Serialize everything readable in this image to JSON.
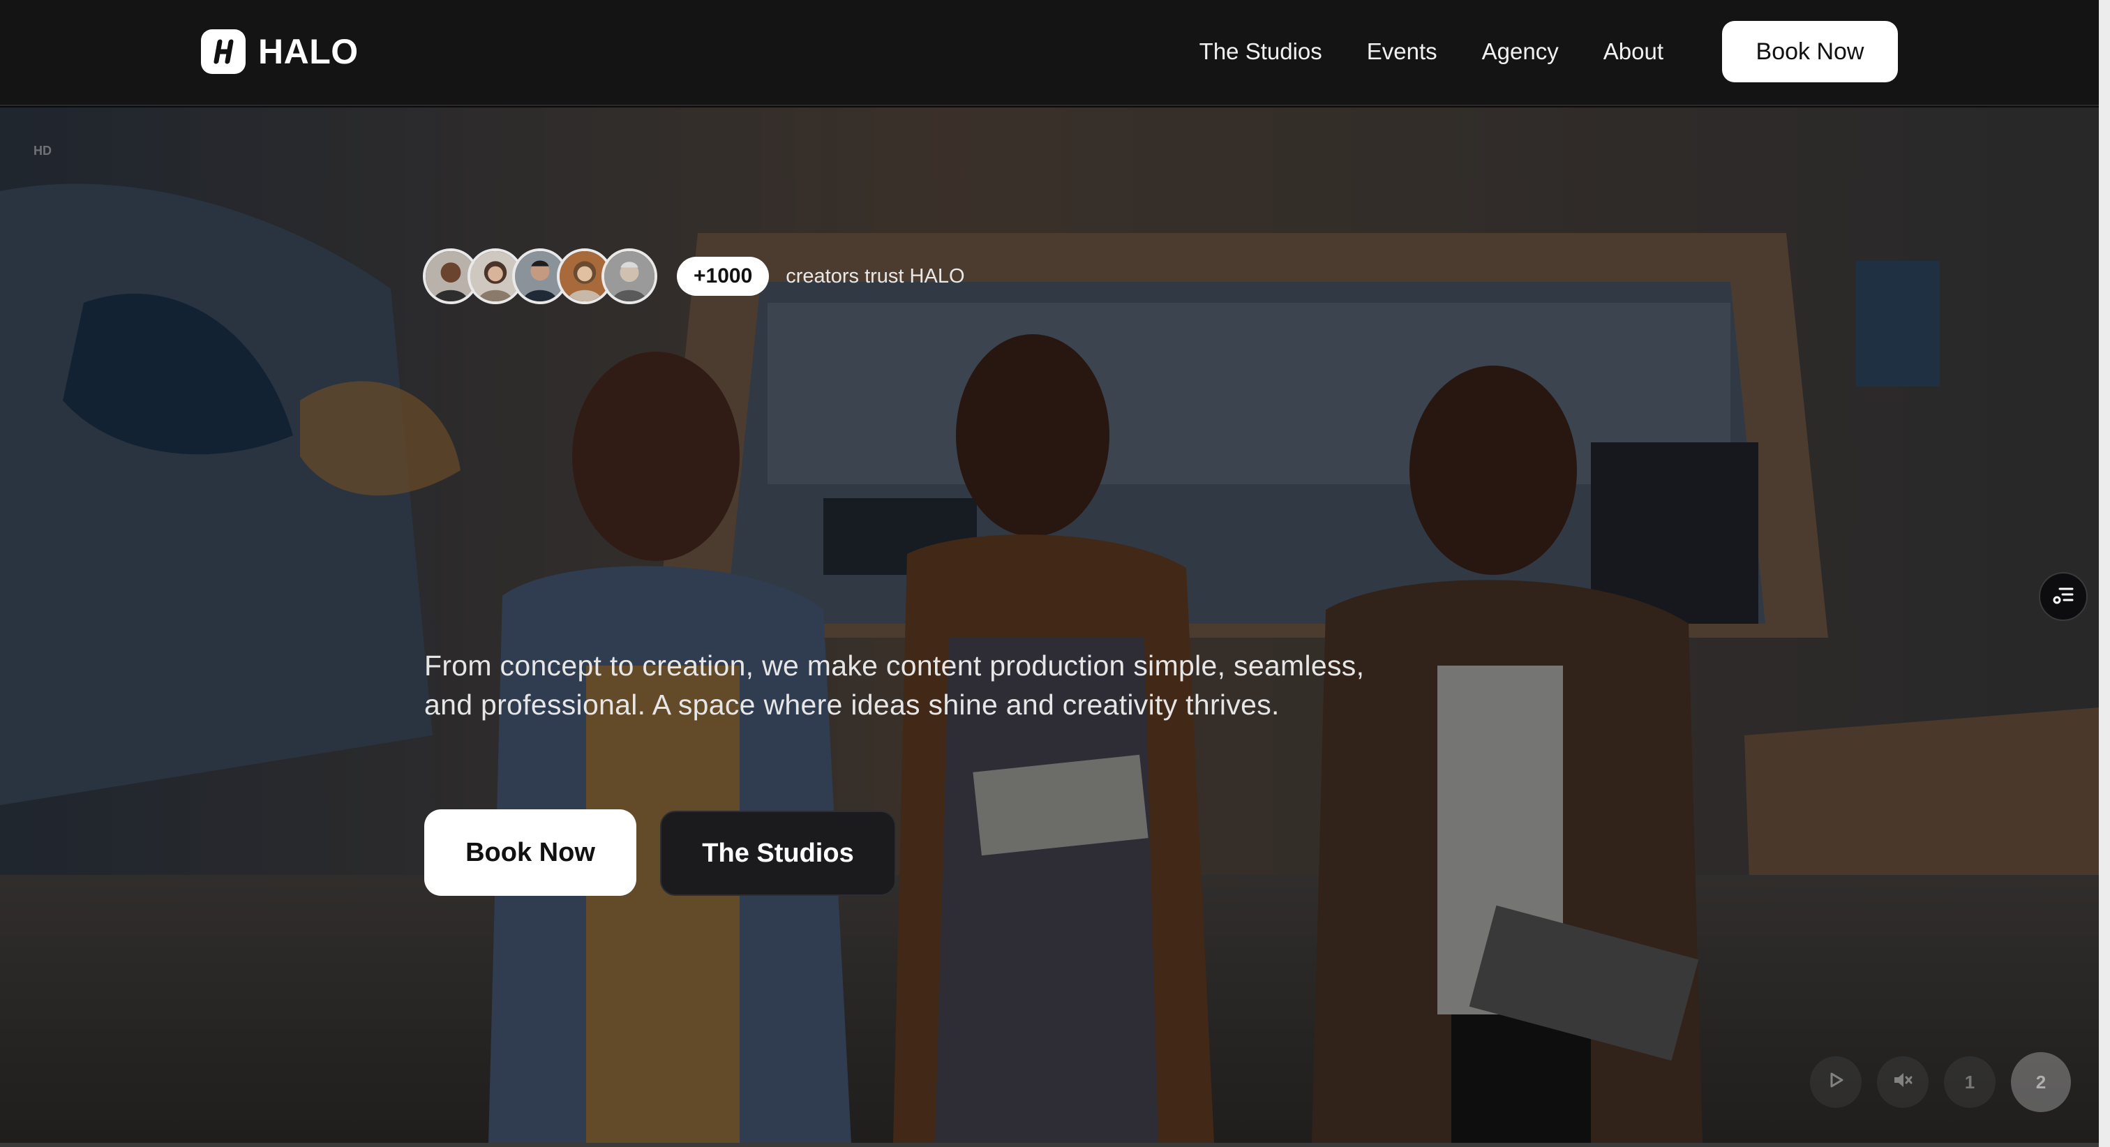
{
  "brand": {
    "name": "HALO",
    "logo_icon": "halo-logo-icon"
  },
  "nav": {
    "links": [
      "The Studios",
      "Events",
      "Agency",
      "About"
    ],
    "cta": "Book Now"
  },
  "hero": {
    "video_quality": "HD",
    "trust": {
      "count": "+1000",
      "text": "creators trust HALO",
      "avatar_count": 5
    },
    "description": "From concept to creation, we make content production simple, seamless, and professional. A space where ideas shine and creativity thrives.",
    "primary_cta": "Book Now",
    "secondary_cta": "The Studios"
  },
  "slider": {
    "controls": [
      {
        "icon": "play-icon",
        "label": ""
      },
      {
        "icon": "volume-icon",
        "label": ""
      },
      {
        "icon": "",
        "label": "1"
      },
      {
        "icon": "",
        "label": "2"
      }
    ],
    "active_slide": "2"
  },
  "side_button": {
    "icon": "filter-settings-icon"
  },
  "colors": {
    "header_bg": "#141414",
    "button_light": "#ffffff",
    "button_dark": "#1b1a1d"
  }
}
